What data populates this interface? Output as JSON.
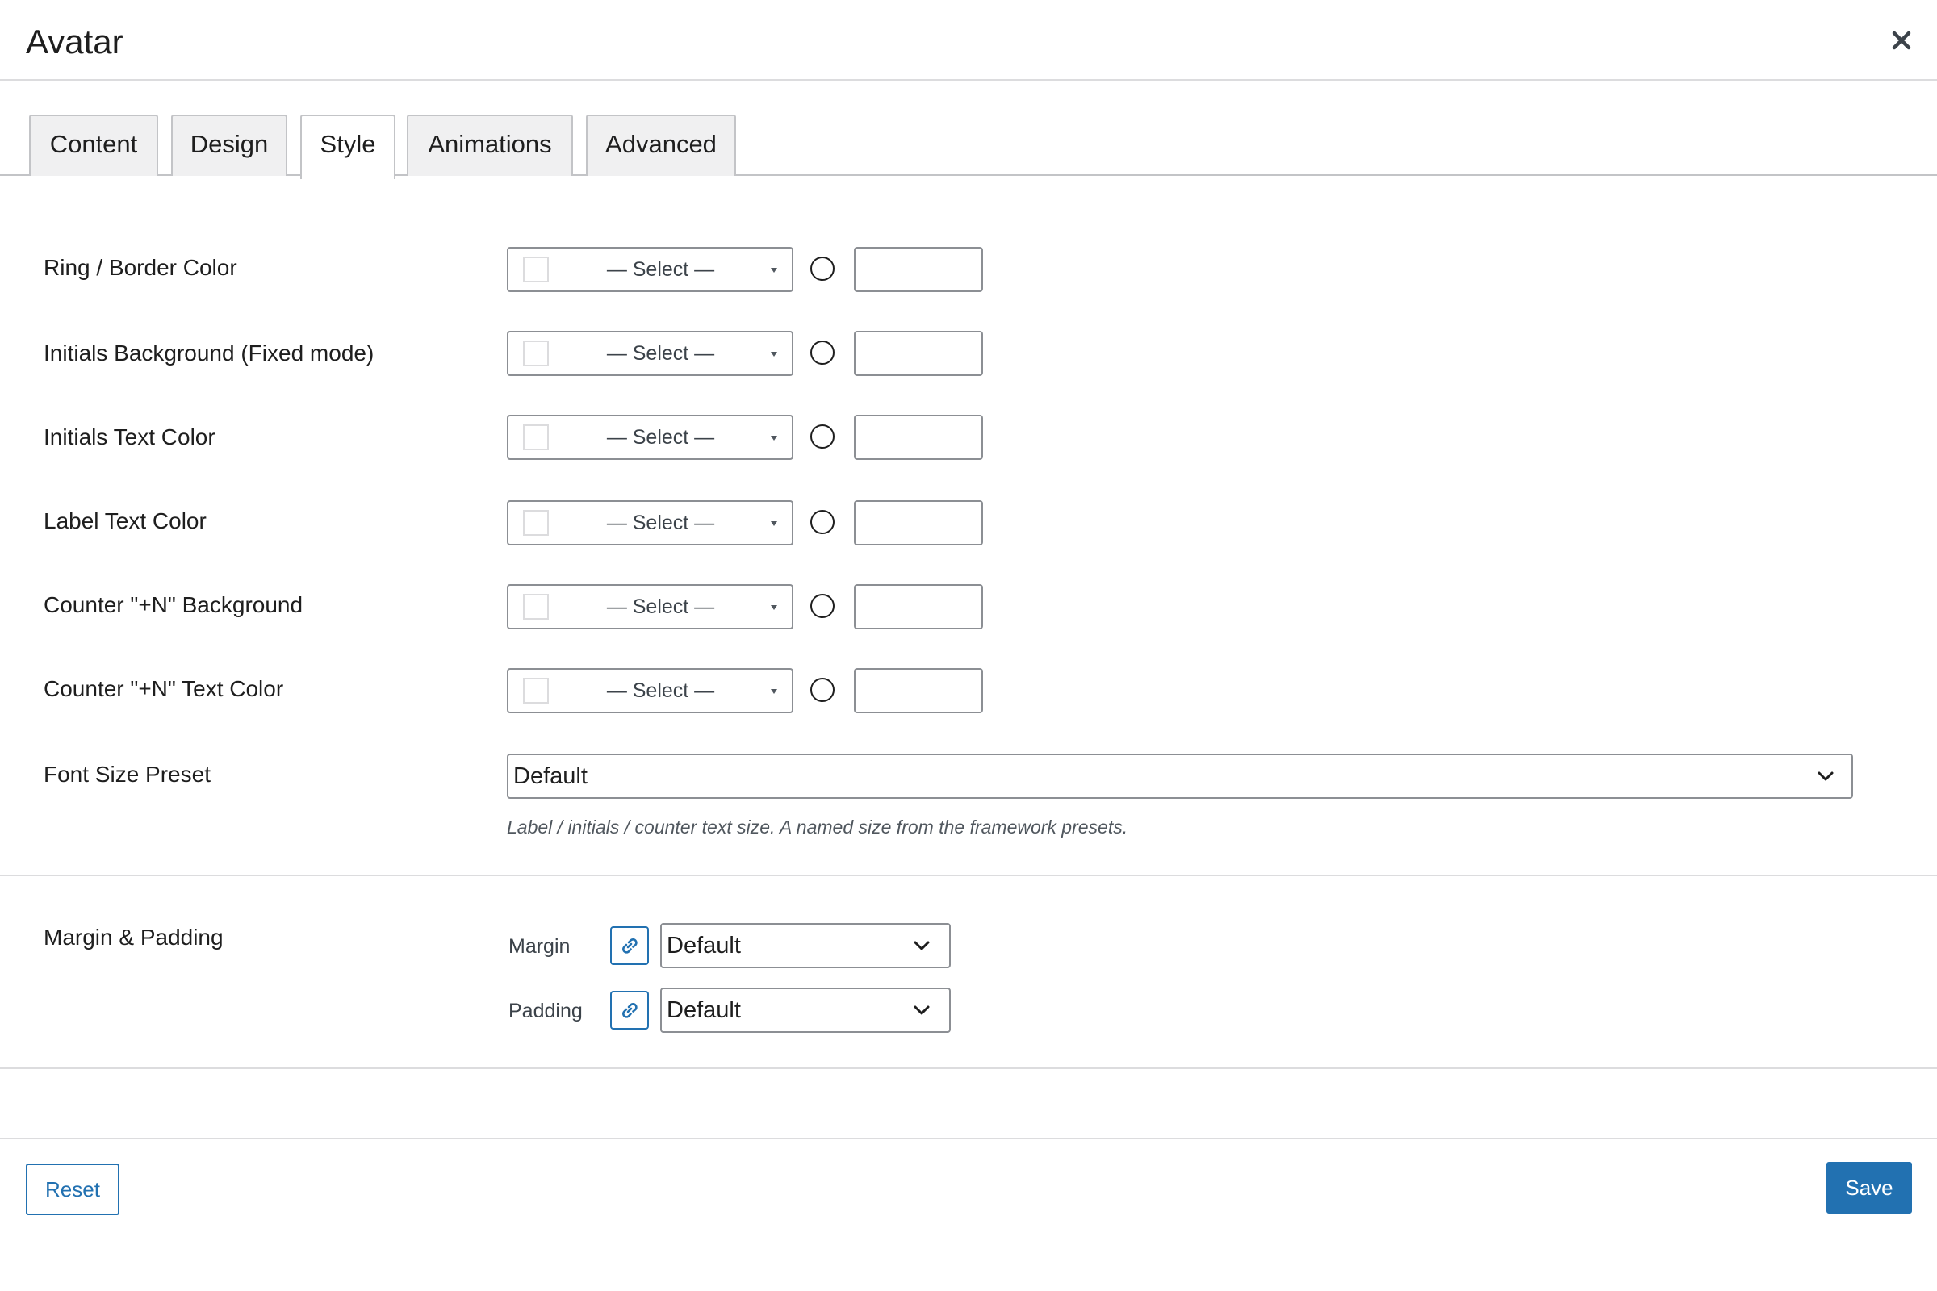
{
  "dialog": {
    "title": "Avatar"
  },
  "tabs": [
    {
      "label": "Content",
      "active": false
    },
    {
      "label": "Design",
      "active": false
    },
    {
      "label": "Style",
      "active": true
    },
    {
      "label": "Animations",
      "active": false
    },
    {
      "label": "Advanced",
      "active": false
    }
  ],
  "color_fields": [
    {
      "label": "Ring / Border Color",
      "select_text": "— Select —",
      "value": ""
    },
    {
      "label": "Initials Background (Fixed mode)",
      "select_text": "— Select —",
      "value": ""
    },
    {
      "label": "Initials Text Color",
      "select_text": "— Select —",
      "value": ""
    },
    {
      "label": "Label Text Color",
      "select_text": "— Select —",
      "value": ""
    },
    {
      "label": "Counter \"+N\" Background",
      "select_text": "— Select —",
      "value": ""
    },
    {
      "label": "Counter \"+N\" Text Color",
      "select_text": "— Select —",
      "value": ""
    }
  ],
  "font_size": {
    "label": "Font Size Preset",
    "value": "Default",
    "help": "Label / initials / counter text size. A named size from the framework presets."
  },
  "spacing": {
    "label": "Margin & Padding",
    "margin_label": "Margin",
    "margin_value": "Default",
    "padding_label": "Padding",
    "padding_value": "Default"
  },
  "footer": {
    "reset_label": "Reset",
    "save_label": "Save"
  },
  "colors": {
    "accent": "#2271b1",
    "border": "#8c8f94",
    "tab_bg": "#f0f0f1"
  },
  "icons": {
    "close": "close-icon",
    "link": "link-icon",
    "chevron": "chevron-down-icon"
  }
}
